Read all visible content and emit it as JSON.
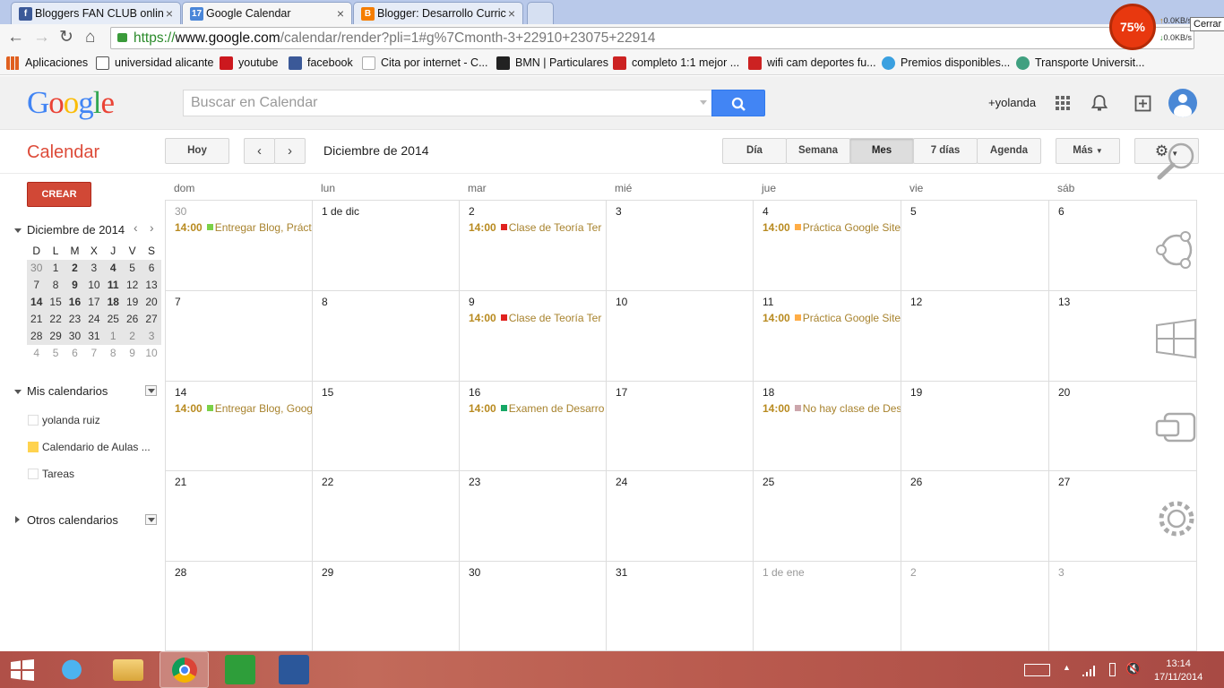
{
  "browser": {
    "tabs": [
      {
        "title": "Bloggers FAN CLUB onlin",
        "favicon": "facebook-f",
        "color": "#3b5998",
        "active": false
      },
      {
        "title": "Google Calendar",
        "favicon": "17",
        "color": "#4a86d8",
        "active": true
      },
      {
        "title": "Blogger: Desarrollo Curric",
        "favicon": "blogger-b",
        "color": "#f57d00",
        "active": false
      }
    ],
    "url_scheme": "https://",
    "url_host": "www.google.com",
    "url_path": "/calendar/render?pli=1#g%7Cmonth-3+22910+23075+22914",
    "bookmarks": [
      {
        "label": "Aplicaciones",
        "color": "#e06020"
      },
      {
        "label": "universidad alicante",
        "color": "#555555"
      },
      {
        "label": "youtube",
        "color": "#cc181e"
      },
      {
        "label": "facebook",
        "color": "#3b5998"
      },
      {
        "label": "Cita por internet - C...",
        "color": "#dddddd"
      },
      {
        "label": "BMN | Particulares",
        "color": "#222222"
      },
      {
        "label": "completo 1:1 mejor ...",
        "color": "#cc2222"
      },
      {
        "label": "wifi cam deportes fu...",
        "color": "#cc2222"
      },
      {
        "label": "Premios disponibles...",
        "color": "#3aa0e0"
      },
      {
        "label": "Transporte Universit...",
        "color": "#40a080"
      }
    ],
    "extension_percent": "75%",
    "net_up": "0.0KB/s",
    "net_down": "0.0KB/s",
    "tooltip": "Cerrar"
  },
  "gcal": {
    "search_placeholder": "Buscar en Calendar",
    "user": "+yolanda",
    "app_title": "Calendar",
    "today_label": "Hoy",
    "month_title": "Diciembre de 2014",
    "views": [
      "Día",
      "Semana",
      "Mes",
      "7 días",
      "Agenda"
    ],
    "selected_view": "Mes",
    "more_label": "Más",
    "create_label": "CREAR",
    "mini_cal": {
      "title": "Diciembre de 2014",
      "headers": [
        "D",
        "L",
        "M",
        "X",
        "J",
        "V",
        "S"
      ],
      "weeks": [
        [
          "30",
          "1",
          "2",
          "3",
          "4",
          "5",
          "6"
        ],
        [
          "7",
          "8",
          "9",
          "10",
          "11",
          "12",
          "13"
        ],
        [
          "14",
          "15",
          "16",
          "17",
          "18",
          "19",
          "20"
        ],
        [
          "21",
          "22",
          "23",
          "24",
          "25",
          "26",
          "27"
        ],
        [
          "28",
          "29",
          "30",
          "31",
          "1",
          "2",
          "3"
        ],
        [
          "4",
          "5",
          "6",
          "7",
          "8",
          "9",
          "10"
        ]
      ]
    },
    "my_calendars_title": "Mis calendarios",
    "my_calendars": [
      {
        "name": "yolanda ruiz",
        "color": "#ffffff"
      },
      {
        "name": "Calendario de Aulas ...",
        "color": "#ffd34f"
      },
      {
        "name": "Tareas",
        "color": "#ffffff"
      }
    ],
    "other_calendars_title": "Otros calendarios",
    "weekdays": [
      "dom",
      "lun",
      "mar",
      "mié",
      "jue",
      "vie",
      "sáb"
    ],
    "weeks": [
      [
        {
          "label": "30",
          "out": true,
          "event": {
            "time": "14:00",
            "title": "Entregar Blog, Práct",
            "color": "#7bd148"
          }
        },
        {
          "label": "1 de dic",
          "out": false
        },
        {
          "label": "2",
          "out": false,
          "event": {
            "time": "14:00",
            "title": "Clase de Teoría Ter",
            "color": "#e0221f"
          }
        },
        {
          "label": "3",
          "out": false
        },
        {
          "label": "4",
          "out": false,
          "event": {
            "time": "14:00",
            "title": "Práctica Google Site",
            "color": "#ffad46"
          }
        },
        {
          "label": "5",
          "out": false
        },
        {
          "label": "6",
          "out": false
        }
      ],
      [
        {
          "label": "7",
          "out": false
        },
        {
          "label": "8",
          "out": false
        },
        {
          "label": "9",
          "out": false,
          "event": {
            "time": "14:00",
            "title": "Clase de Teoría Ter",
            "color": "#e0221f"
          }
        },
        {
          "label": "10",
          "out": false
        },
        {
          "label": "11",
          "out": false,
          "event": {
            "time": "14:00",
            "title": "Práctica Google Site",
            "color": "#ffad46"
          }
        },
        {
          "label": "12",
          "out": false
        },
        {
          "label": "13",
          "out": false
        }
      ],
      [
        {
          "label": "14",
          "out": false,
          "event": {
            "time": "14:00",
            "title": "Entregar Blog, Goog",
            "color": "#7bd148"
          }
        },
        {
          "label": "15",
          "out": false
        },
        {
          "label": "16",
          "out": false,
          "event": {
            "time": "14:00",
            "title": "Examen de Desarro",
            "color": "#16a765"
          }
        },
        {
          "label": "17",
          "out": false
        },
        {
          "label": "18",
          "out": false,
          "event": {
            "time": "14:00",
            "title": "No hay clase de Des",
            "color": "#cca6ac"
          }
        },
        {
          "label": "19",
          "out": false
        },
        {
          "label": "20",
          "out": false
        }
      ],
      [
        {
          "label": "21",
          "out": false
        },
        {
          "label": "22",
          "out": false
        },
        {
          "label": "23",
          "out": false
        },
        {
          "label": "24",
          "out": false
        },
        {
          "label": "25",
          "out": false
        },
        {
          "label": "26",
          "out": false
        },
        {
          "label": "27",
          "out": false
        }
      ],
      [
        {
          "label": "28",
          "out": false
        },
        {
          "label": "29",
          "out": false
        },
        {
          "label": "30",
          "out": false
        },
        {
          "label": "31",
          "out": false
        },
        {
          "label": "1 de ene",
          "out": true
        },
        {
          "label": "2",
          "out": true
        },
        {
          "label": "3",
          "out": true
        }
      ]
    ]
  },
  "taskbar": {
    "time": "13:14",
    "date": "17/11/2014",
    "apps": [
      "start-icon",
      "internet-explorer-icon",
      "file-explorer-icon",
      "chrome-icon",
      "windows-store-icon",
      "word-icon"
    ]
  }
}
